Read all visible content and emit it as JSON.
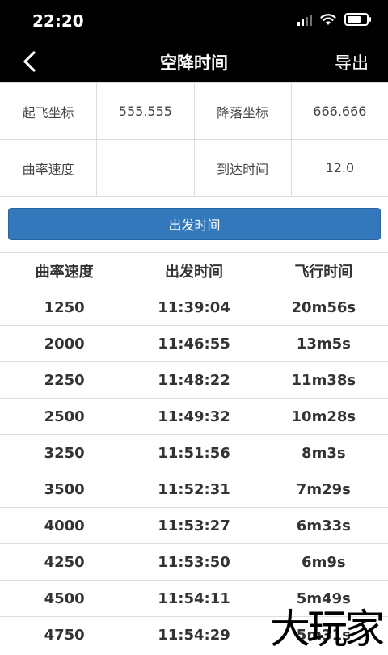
{
  "status_bar": {
    "time": "22:20"
  },
  "nav": {
    "title": "空降时间",
    "export_label": "导出"
  },
  "info": {
    "takeoff_label": "起飞坐标",
    "takeoff_value": "555.555",
    "landing_label": "降落坐标",
    "landing_value": "666.666",
    "curve_label": "曲率速度",
    "curve_value": "",
    "arrival_label": "到达时间",
    "arrival_value": "12.0"
  },
  "button": {
    "label": "出发时间"
  },
  "table": {
    "headers": [
      "曲率速度",
      "出发时间",
      "飞行时间"
    ],
    "rows": [
      [
        "1250",
        "11:39:04",
        "20m56s"
      ],
      [
        "2000",
        "11:46:55",
        "13m5s"
      ],
      [
        "2250",
        "11:48:22",
        "11m38s"
      ],
      [
        "2500",
        "11:49:32",
        "10m28s"
      ],
      [
        "3250",
        "11:51:56",
        "8m3s"
      ],
      [
        "3500",
        "11:52:31",
        "7m29s"
      ],
      [
        "4000",
        "11:53:27",
        "6m33s"
      ],
      [
        "4250",
        "11:53:50",
        "6m9s"
      ],
      [
        "4500",
        "11:54:11",
        "5m49s"
      ],
      [
        "4750",
        "11:54:29",
        "5m31s"
      ]
    ]
  },
  "watermark": "大玩家",
  "icons": {
    "back": "back-arrow-icon",
    "signal": "signal-icon",
    "wifi": "wifi-icon",
    "battery": "battery-icon"
  },
  "colors": {
    "accent": "#3278bb",
    "bar": "#000000"
  }
}
